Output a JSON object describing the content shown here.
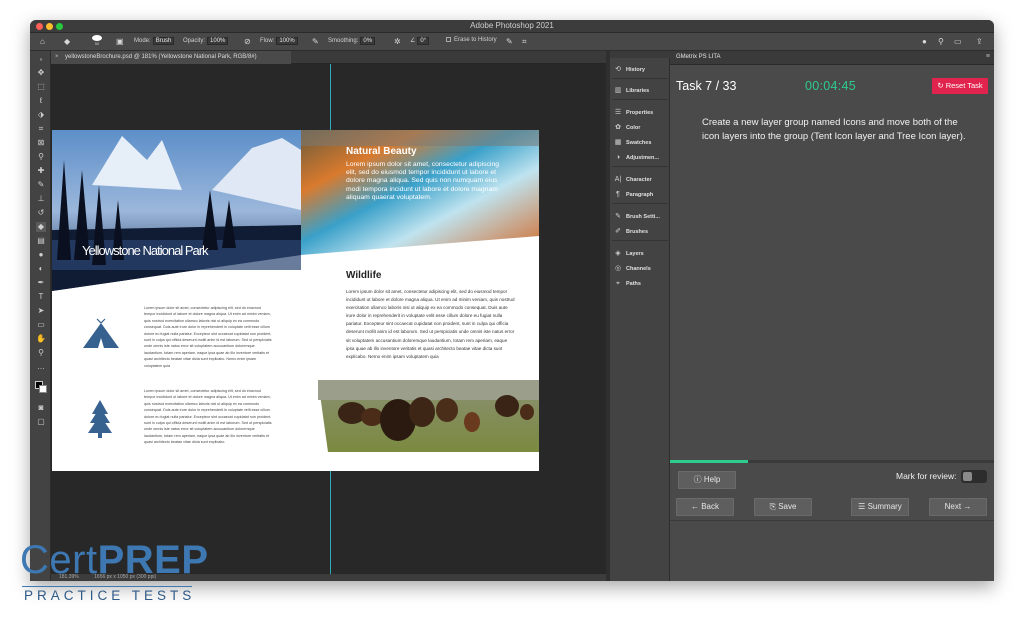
{
  "window": {
    "title": "Adobe Photoshop 2021"
  },
  "options_bar": {
    "mode_label": "Mode:",
    "mode_value": "Brush",
    "opacity_label": "Opacity:",
    "opacity_value": "100%",
    "flow_label": "Flow:",
    "flow_value": "100%",
    "smoothing_label": "Smoothing:",
    "smoothing_value": "0%",
    "angle_value": "0°",
    "brush_size": "50",
    "erase_history_label": "Erase to History"
  },
  "document_tab": {
    "label": "yellowstoneBrochure.psd @ 181% (Yellowstone National Park, RGB/8#)"
  },
  "document": {
    "cover_title": "Yellowstone National Park",
    "natural_heading": "Natural Beauty",
    "natural_body": "Lorem ipsum dolor sit amet, consectetur adipiscing elit, sed do eiusmod tempor incididunt ut labore et dolore magna aliqua. Sed quis non numquam eius modi tempora incidunt ut labore et dolore magnam aliquam quaerat voluptatem.",
    "wildlife_heading": "Wildlife",
    "wildlife_body": "Lorem ipsum dolor sit amet, consectetur adipiscing elit, sed do eiusmod tempor incididunt ut labore et dolore magna aliqua. Ut enim ad minim veniam, quis nostrud exercitation ullamco laboris nisi ut aliquip ex ea commodo consequat. Duis aute irure dolor in reprehenderit in voluptate velit esse cillum dolore eu fugiat nulla pariatur. Excepteur sint occaecat cupidatat non proident, sunt in culpa qui officia deserunt mollit anim id est laborum. Sed ut perspiciatis unde omnis iste natus error sit voluptatem accusantium doloremque laudantium, totam rem aperiam, eaque ipsa quae ab illo inventore veritatis et quasi architecto beatae vitae dicta sunt explicabo. Nemo enim ipsam voluptatem quia",
    "tent_body": "Lorem ipsum dolor sit amet, consectetur adipiscing elit, sed do eiusmod tempor incididunt ut labore et dolore magna aliqua. Ut enim ad minim veniam, quis nostrud exercitation ullamco laboris nisi ut aliquip ex ea commodo consequat. Duis aute irure dolor in reprehenderit in voluptate velit esse cillum dolore eu fugiat nulla pariatur. Excepteur sint occaecat cupidatat non proident, sunt in culpa qui officia deserunt mollit anim id est laborum. Sed ut perspiciatis unde omnis iste natus error sit voluptatem accusantium doloremque laudantium, totam rem aperiam, eaque ipsa quae ab illo inventore veritatis et quasi architecto beatae vitae dicta sunt explicabo. Nemo enim ipsam voluptatem quia",
    "tree_body": "Lorem ipsum dolor sit amet, consectetur adipiscing elit, sed do eiusmod tempor incididunt ut labore et dolore magna aliqua. Ut enim ad minim veniam, quis nostrud exercitation ullamco laboris nisi ut aliquip ex ea commodo consequat. Duis aute irure dolor in reprehenderit in voluptate velit esse cillum dolore eu fugiat nulla pariatur. Excepteur sint occaecat cupidatat non proident, sunt in culpa qui officia deserunt mollit anim id est laborum. Sed ut perspiciatis unde omnis iste natus error sit voluptatem accusantium doloremque laudantium, totam rem aperiam, eaque ipsa quae ab illo inventore veritatis et quasi architecto beatae vitae dicta sunt explicabo."
  },
  "status_bar": {
    "zoom": "181.39%",
    "size": "1656 px x 1050 px (300 ppi)"
  },
  "side_panels": [
    {
      "label": "History",
      "icon": "history-icon"
    },
    {
      "label": "Libraries",
      "icon": "libraries-icon"
    },
    {
      "label": "Properties",
      "icon": "properties-icon"
    },
    {
      "label": "Color",
      "icon": "color-icon"
    },
    {
      "label": "Swatches",
      "icon": "swatches-icon"
    },
    {
      "label": "Adjustmen...",
      "icon": "adjustments-icon"
    },
    {
      "label": "Character",
      "icon": "character-icon"
    },
    {
      "label": "Paragraph",
      "icon": "paragraph-icon"
    },
    {
      "label": "Brush Setti...",
      "icon": "brush-settings-icon"
    },
    {
      "label": "Brushes",
      "icon": "brushes-icon"
    },
    {
      "label": "Layers",
      "icon": "layers-icon"
    },
    {
      "label": "Channels",
      "icon": "channels-icon"
    },
    {
      "label": "Paths",
      "icon": "paths-icon"
    }
  ],
  "gmetrix": {
    "title": "GMetrix PS LITA",
    "task": "Task 7 / 33",
    "timer": "00:04:45",
    "reset_label": "Reset Task",
    "instructions": "Create a new layer group named Icons and move both of the icon layers into the group (Tent Icon layer and Tree Icon layer).",
    "progress": 0.24,
    "help_label": "Help",
    "mark_label": "Mark for review:",
    "back_label": "Back",
    "save_label": "Save",
    "summary_label": "Summary",
    "next_label": "Next"
  },
  "logo": {
    "cert": "Cert",
    "prep": "PREP",
    "sub": "PRACTICE TESTS"
  },
  "colors": {
    "accent_green": "#2ecc8f",
    "reset_red": "#e0244d",
    "logo_blue": "#3e78b2",
    "tent_tree_blue": "#37618f"
  }
}
